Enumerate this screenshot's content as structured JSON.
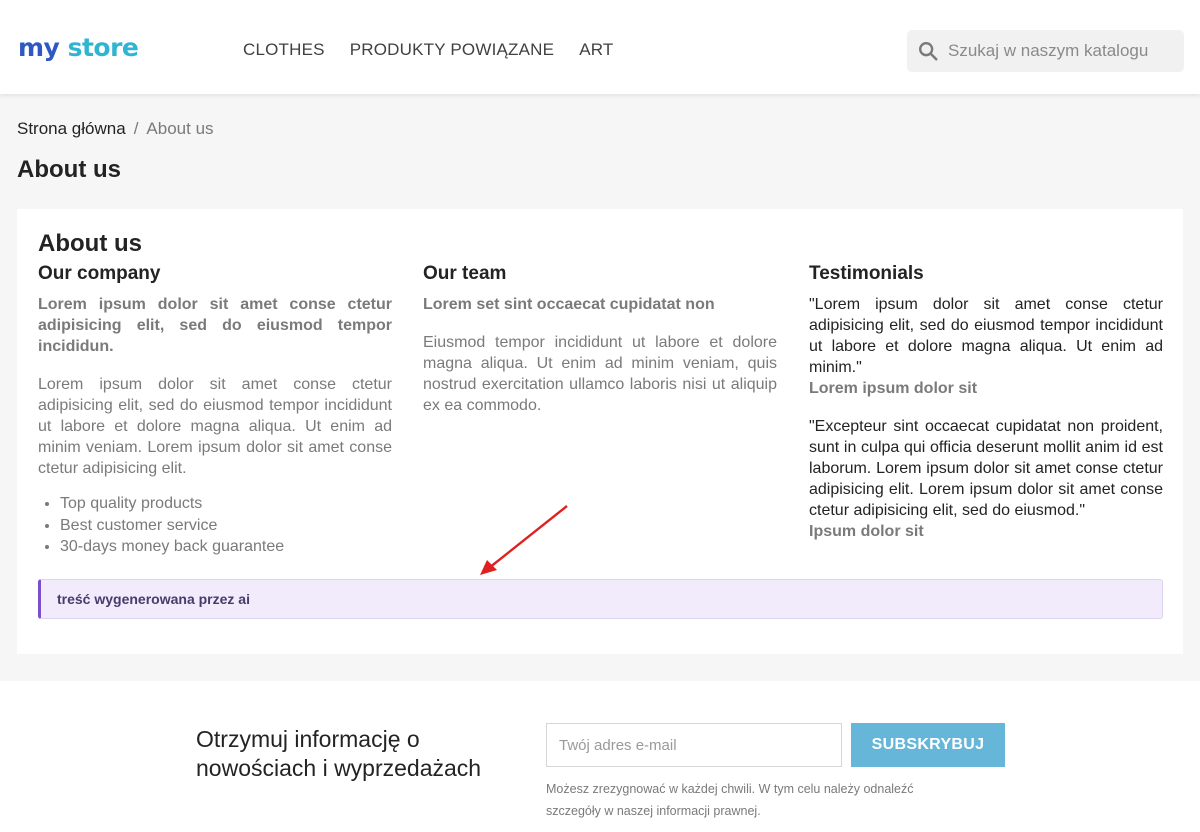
{
  "header": {
    "logo_word1": "my",
    "logo_word2": "store",
    "nav": [
      {
        "label": "CLOTHES"
      },
      {
        "label": "PRODUKTY POWIĄZANE"
      },
      {
        "label": "ART"
      }
    ],
    "search": {
      "placeholder": "Szukaj w naszym katalogu"
    }
  },
  "breadcrumb": {
    "home": "Strona główna",
    "separator": "/",
    "current": "About us"
  },
  "page_title": "About us",
  "content": {
    "title": "About us",
    "company": {
      "heading": "Our company",
      "lead": "Lorem ipsum dolor sit amet conse ctetur adipisicing elit, sed do eiusmod tempor incididun.",
      "body": "Lorem ipsum dolor sit amet conse ctetur adipisicing elit, sed do eiusmod tempor incididunt ut labore et dolore magna aliqua. Ut enim ad minim veniam. Lorem ipsum dolor sit amet conse ctetur adipisicing elit.",
      "bullets": [
        "Top quality products",
        "Best customer service",
        "30-days money back guarantee"
      ]
    },
    "team": {
      "heading": "Our team",
      "lead": "Lorem set sint occaecat cupidatat non",
      "body": "Eiusmod tempor incididunt ut labore et dolore magna aliqua. Ut enim ad minim veniam, quis nostrud exercitation ullamco laboris nisi ut aliquip ex ea commodo."
    },
    "testimonials": {
      "heading": "Testimonials",
      "items": [
        {
          "quote": "\"Lorem ipsum dolor sit amet conse ctetur adipisicing elit, sed do eiusmod tempor incididunt ut labore et dolore magna aliqua. Ut enim ad minim.\"",
          "author": "Lorem ipsum dolor sit"
        },
        {
          "quote": "\"Excepteur sint occaecat cupidatat non proident, sunt in culpa qui officia deserunt mollit anim id est laborum. Lorem ipsum dolor sit amet conse ctetur adipisicing elit. Lorem ipsum dolor sit amet conse ctetur adipisicing elit, sed do eiusmod.\"",
          "author": "Ipsum dolor sit"
        }
      ]
    },
    "ai_note": "treść wygenerowana przez ai"
  },
  "newsletter": {
    "title": "Otrzymuj informację o nowościach i wyprzedażach",
    "email_placeholder": "Twój adres e-mail",
    "button": "SUBSKRYBUJ",
    "info": "Możesz zrezygnować w każdej chwili. W tym celu należy odnaleźć szczegóły w naszej informacji prawnej."
  },
  "colors": {
    "accent": "#65b6d9",
    "arrow": "#e02020",
    "note_border": "#7a4fc9"
  }
}
